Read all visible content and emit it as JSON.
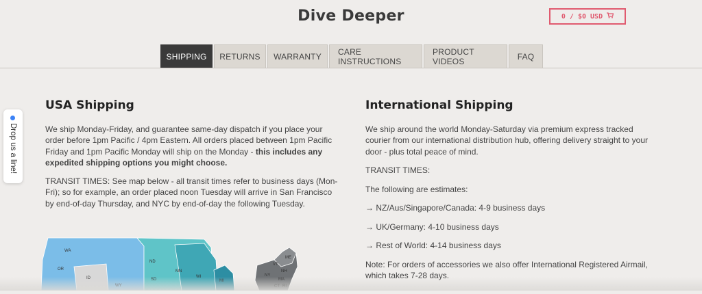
{
  "header": {
    "brand": "Dive Deeper",
    "cart_label": "0 / $0 USD",
    "cart_icon": "cart-icon"
  },
  "tabs": [
    {
      "label": "SHIPPING",
      "active": true
    },
    {
      "label": "RETURNS",
      "active": false
    },
    {
      "label": "WARRANTY",
      "active": false
    },
    {
      "label": "CARE INSTRUCTIONS",
      "active": false
    },
    {
      "label": "PRODUCT VIDEOS",
      "active": false
    },
    {
      "label": "FAQ",
      "active": false
    }
  ],
  "feedback": {
    "label": "Drop us a line!",
    "dot_color": "#3b82f6"
  },
  "usa": {
    "title": "USA Shipping",
    "p1_text": "We ship Monday-Friday, and guarantee same-day dispatch if you place your order before 1pm Pacific / 4pm Eastern. All orders placed between 1pm Pacific Friday and 1pm Pacific Monday will ship on the Monday - ",
    "p1_bold": "this includes any expedited shipping options you might choose.",
    "p2": "TRANSIT TIMES: See map below - all transit times refer to business days (Mon-Fri); so for example, an order placed noon Tuesday will arrive in San Francisco by end-of-day Thursday, and NYC by end-of-day the following Tuesday."
  },
  "map": {
    "states": [
      "WA",
      "OR",
      "ID",
      "WY",
      "ND",
      "SD",
      "MN",
      "WI",
      "MI",
      "VT",
      "ME",
      "NH",
      "MA",
      "CT",
      "RI",
      "NY"
    ]
  },
  "intl": {
    "title": "International Shipping",
    "p1": "We ship around the world Monday-Saturday via premium express tracked courier from our international distribution hub, offering delivery straight to your door - plus total peace of mind.",
    "p2": "TRANSIT TIMES:",
    "p3": "The following are estimates:",
    "items": [
      "→ NZ/Aus/Singapore/Canada: 4-9 business days",
      "→ UK/Germany: 4-10 business days",
      "→ Rest of World: 4-14 business days"
    ],
    "note": "Note: For orders of accessories we also offer International Registered Airmail, which takes 7-28 days."
  },
  "colors": {
    "accent_cart": "#e05a6f",
    "active_tab": "#3a3a3a",
    "background": "#efedeb"
  }
}
